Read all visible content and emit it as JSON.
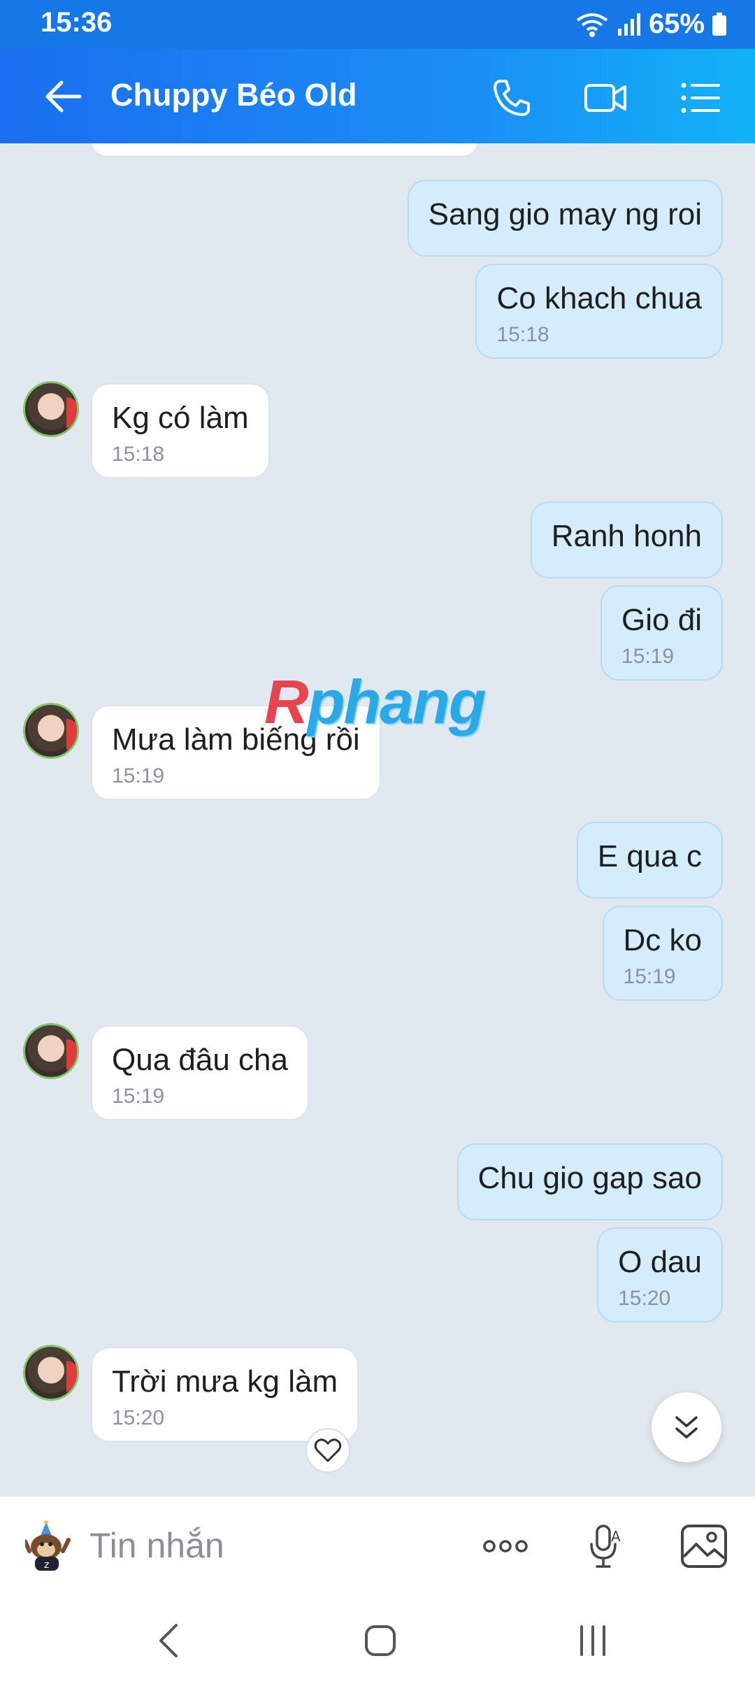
{
  "status_bar": {
    "time": "15:36",
    "battery": "65%"
  },
  "header": {
    "contact_name": "Chuppy Béo Old"
  },
  "watermark": {
    "first_letter": "R",
    "rest": "phang"
  },
  "messages": [
    {
      "dir": "out",
      "text": "Sang gio may ng roi",
      "time": ""
    },
    {
      "dir": "out",
      "text": "Co khach chua",
      "time": "15:18"
    },
    {
      "dir": "in",
      "text": "Kg có làm",
      "time": "15:18"
    },
    {
      "dir": "out",
      "text": "Ranh honh",
      "time": ""
    },
    {
      "dir": "out",
      "text": "Gio đi",
      "time": "15:19"
    },
    {
      "dir": "in",
      "text": "Mưa làm biếng rồi",
      "time": "15:19"
    },
    {
      "dir": "out",
      "text": "E qua c",
      "time": ""
    },
    {
      "dir": "out",
      "text": "Dc ko",
      "time": "15:19"
    },
    {
      "dir": "in",
      "text": "Qua đâu cha",
      "time": "15:19"
    },
    {
      "dir": "out",
      "text": "Chu gio gap sao",
      "time": ""
    },
    {
      "dir": "out",
      "text": "O dau",
      "time": "15:20"
    },
    {
      "dir": "in",
      "text": "Trời mưa kg làm",
      "time": "15:20"
    }
  ],
  "input": {
    "placeholder": "Tin nhắn"
  },
  "icons": {
    "back": "arrow-left-icon",
    "call": "phone-icon",
    "video": "video-camera-icon",
    "menu": "list-menu-icon",
    "sticker": "sticker-icon",
    "more": "more-dots-icon",
    "voice": "microphone-icon",
    "image": "image-icon",
    "heart": "heart-icon",
    "scroll": "double-chevron-down-icon"
  },
  "colors": {
    "header": "#1a7ff0",
    "bubble_out": "#d5ecfd",
    "bubble_in": "#ffffff",
    "chat_bg": "#e2e8f0"
  }
}
